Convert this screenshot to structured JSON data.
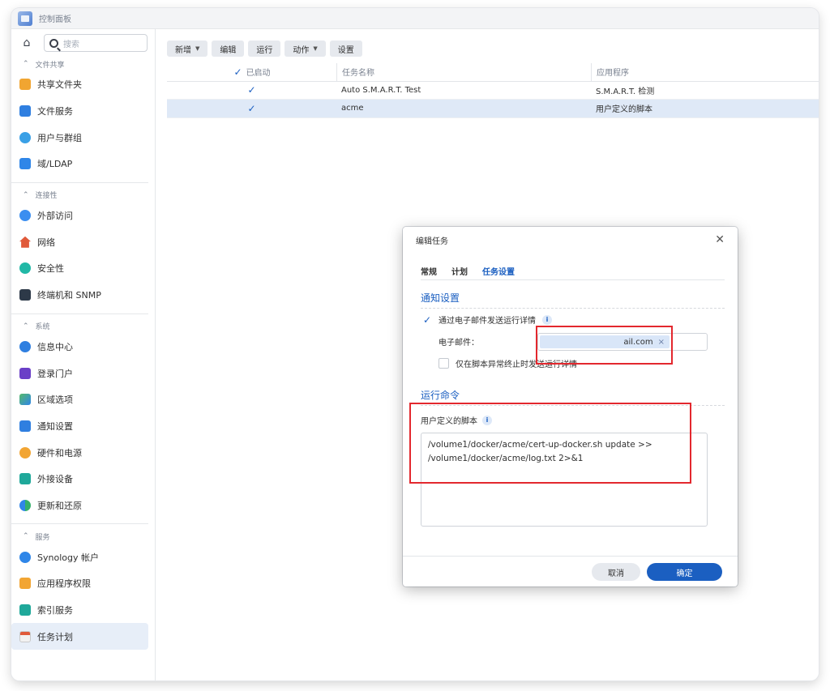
{
  "app": {
    "title": "控制面板"
  },
  "sidebar": {
    "search_placeholder": "搜索",
    "groups": [
      {
        "header": "文件共享",
        "items": [
          "共享文件夹",
          "文件服务",
          "用户与群组",
          "域/LDAP"
        ]
      },
      {
        "header": "连接性",
        "items": [
          "外部访问",
          "网络",
          "安全性",
          "终端机和 SNMP"
        ]
      },
      {
        "header": "系统",
        "items": [
          "信息中心",
          "登录门户",
          "区域选项",
          "通知设置",
          "硬件和电源",
          "外接设备",
          "更新和还原"
        ]
      },
      {
        "header": "服务",
        "items": [
          "Synology 帐户",
          "应用程序权限",
          "索引服务",
          "任务计划"
        ]
      }
    ]
  },
  "toolbar": {
    "create": "新增",
    "edit": "编辑",
    "run": "运行",
    "action": "动作",
    "settings": "设置"
  },
  "table": {
    "columns": [
      "已启动",
      "任务名称",
      "应用程序"
    ],
    "rows": [
      {
        "enabled": true,
        "name": "Auto S.M.A.R.T. Test",
        "app": "S.M.A.R.T. 检测"
      },
      {
        "enabled": true,
        "name": "acme",
        "app": "用户定义的脚本"
      }
    ]
  },
  "dialog": {
    "title": "编辑任务",
    "tabs": [
      "常规",
      "计划",
      "任务设置"
    ],
    "active_tab": "任务设置",
    "notify_section": "通知设置",
    "send_email_label": "通过电子邮件发送运行详情",
    "email_label": "电子邮件：",
    "email_value": "ail.com",
    "abnormal_label": "仅在脚本异常终止时发送运行详情",
    "command_section": "运行命令",
    "script_label": "用户定义的脚本",
    "script_line1": "/volume1/docker/acme/cert-up-docker.sh update >>",
    "script_line2": "/volume1/docker/acme/log.txt 2>&1",
    "cancel": "取消",
    "ok": "确定"
  },
  "colors": {
    "accent": "#1b5fc1",
    "highlight": "#e3282e"
  }
}
